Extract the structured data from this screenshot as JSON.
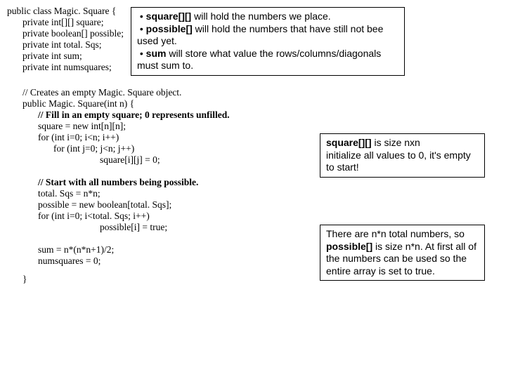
{
  "code": {
    "l1": "public class Magic. Square {",
    "l2": "private int[][] square;",
    "l3": "private boolean[] possible;",
    "l4": "private int total. Sqs;",
    "l5": "private int sum;",
    "l6": "private int numsquares;",
    "c1": "// Creates an empty Magic. Square object.",
    "c2": "public Magic. Square(int n) {",
    "c3": "// Fill in an empty square; 0 represents unfilled.",
    "c4": "square = new int[n][n];",
    "c5": "for (int i=0; i<n; i++)",
    "c6": "for (int j=0; j<n; j++)",
    "c7": "square[i][j] = 0;",
    "c8": "// Start with all numbers being possible.",
    "c9": "total. Sqs = n*n;",
    "c10": "possible = new boolean[total. Sqs];",
    "c11": "for (int i=0; i<total. Sqs; i++)",
    "c12": "possible[i] = true;",
    "c13": "sum = n*(n*n+1)/2;",
    "c14": "numsquares = 0;",
    "c15": "}"
  },
  "box1": {
    "b1a": "square[][]",
    "b1b": " will hold the numbers we place.",
    "b2a": "possible[]",
    "b2b": " will hold the numbers that have still not bee used yet.",
    "b3a": "sum",
    "b3b": " will store what value the rows/columns/diagonals must sum to."
  },
  "box2": {
    "t1a": "square[][]",
    "t1b": " is size nxn",
    "t2": "initialize all values to 0, it's empty to start!"
  },
  "box3": {
    "t1": "There are n*n total numbers, so ",
    "t1b": "possible[]",
    "t1c": " is size n*n.   At first all of the numbers can be used so the entire array is set to true."
  }
}
